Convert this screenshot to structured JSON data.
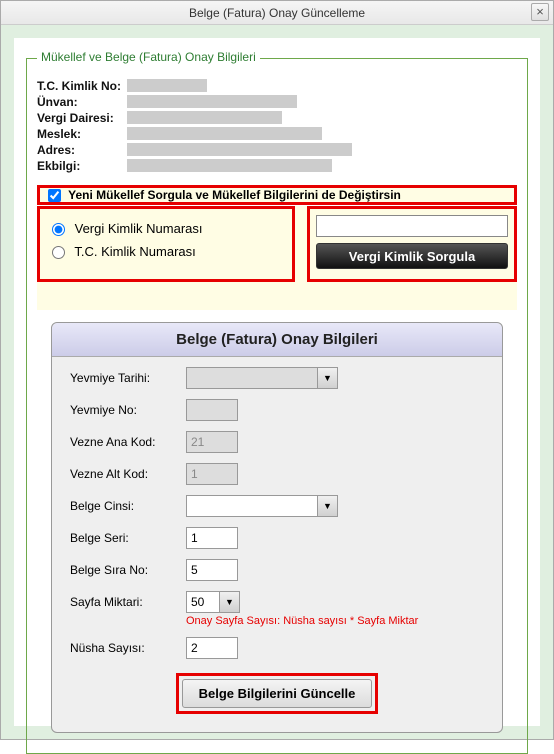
{
  "window": {
    "title": "Belge (Fatura) Onay Güncelleme",
    "close": "×"
  },
  "fieldset1": {
    "legend": "Mükellef ve Belge (Fatura) Onay Bilgileri"
  },
  "info": {
    "tckimlik_label": "T.C. Kimlik No:",
    "unvan_label": "Ünvan:",
    "vergidairesi_label": "Vergi Dairesi:",
    "meslek_label": "Meslek:",
    "adres_label": "Adres:",
    "ekbilgi_label": "Ekbilgi:"
  },
  "checkbox": {
    "label": "Yeni Mükellef Sorgula ve Mükellef Bilgilerini de Değiştirsin"
  },
  "radio": {
    "vkn": "Vergi Kimlik Numarası",
    "tckn": "T.C. Kimlik Numarası"
  },
  "query": {
    "input_value": "",
    "button": "Vergi Kimlik Sorgula"
  },
  "panel": {
    "title": "Belge (Fatura) Onay Bilgileri"
  },
  "form": {
    "yevmiye_tarihi_label": "Yevmiye Tarihi:",
    "yevmiye_tarihi_value": "",
    "yevmiye_no_label": "Yevmiye No:",
    "yevmiye_no_value": "",
    "vezne_ana_label": "Vezne Ana Kod:",
    "vezne_ana_value": "21",
    "vezne_alt_label": "Vezne Alt Kod:",
    "vezne_alt_value": "1",
    "belge_cinsi_label": "Belge Cinsi:",
    "belge_cinsi_value": "",
    "belge_seri_label": "Belge Seri:",
    "belge_seri_value": "1",
    "belge_sira_label": "Belge Sıra No:",
    "belge_sira_value": "5",
    "sayfa_miktari_label": "Sayfa Miktari:",
    "sayfa_miktari_value": "50",
    "sayfa_note": "Onay Sayfa Sayısı: Nüsha sayısı * Sayfa Miktar",
    "nusha_label": "Nüsha Sayısı:",
    "nusha_value": "2",
    "update_button": "Belge Bilgilerini Güncelle"
  }
}
